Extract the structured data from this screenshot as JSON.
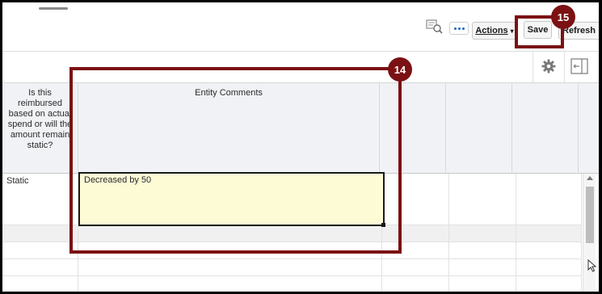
{
  "toolbar": {
    "actions_label": "Actions",
    "actions_caret": "▾",
    "save_label": "Save",
    "refresh_label": "Refresh"
  },
  "grid": {
    "headers": [
      "Is this reimbursed based on actual spend or will the amount remain static?",
      "Entity Comments",
      "",
      "",
      "",
      ""
    ],
    "rows": [
      {
        "static": "Static",
        "comment": "Decreased by 50"
      },
      {
        "static": "",
        "comment": ""
      },
      {
        "static": "",
        "comment": ""
      },
      {
        "static": "",
        "comment": ""
      }
    ]
  },
  "callouts": {
    "entity_comments_step": "14",
    "save_step": "15"
  },
  "colors": {
    "callout": "#7b1113",
    "edit_cell_bg": "#fdfad6",
    "header_bg": "#f1f2f5"
  },
  "icons": [
    "grabber-icon",
    "inspect-icon",
    "more-icon",
    "gear-icon",
    "panel-toggle-icon",
    "cursor-icon"
  ]
}
